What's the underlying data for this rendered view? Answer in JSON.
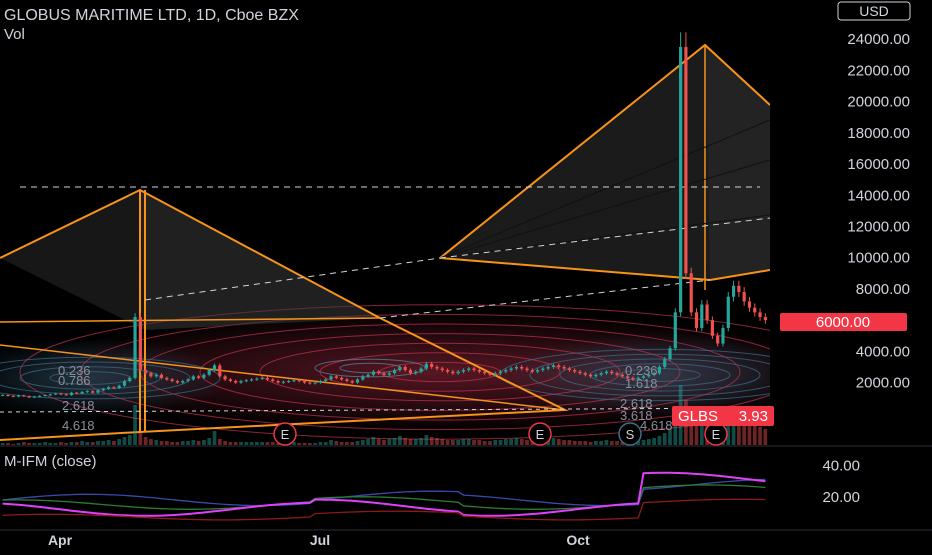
{
  "header": {
    "title": "GLOBUS MARITIME LTD, 1D, Cboe BZX",
    "volume_label": "Vol"
  },
  "currency_button": "USD",
  "indicator_label": "M-IFM (close)",
  "price_badges": [
    {
      "label": "6000.00",
      "value": 6000,
      "color": "#f23645"
    },
    {
      "label": "GLBS",
      "value_text": "3.93",
      "color": "#f23645"
    }
  ],
  "event_markers": [
    {
      "label": "E",
      "kind": "earnings"
    },
    {
      "label": "E",
      "kind": "earnings"
    },
    {
      "label": "S",
      "kind": "split"
    },
    {
      "label": "E",
      "kind": "earnings"
    }
  ],
  "fib_labels": [
    "0.236",
    "0.786",
    "2.618",
    "4.618",
    "0.236",
    "1.618",
    "2.618",
    "3.618",
    "4.618"
  ],
  "colors": {
    "up": "#26a69a",
    "down": "#ef5350",
    "pattern": "#f7931a",
    "fib_blue": "#3d6e8a",
    "fib_red": "#c2334f",
    "ifm_line_1": "#e040fb",
    "ifm_line_2": "#8b1a1a",
    "ifm_line_3": "#3949ab",
    "ifm_line_4": "#2e7d32"
  },
  "chart_data": {
    "type": "candlestick",
    "title": "GLOBUS MARITIME LTD, 1D, Cboe BZX",
    "xlabel": "",
    "ylabel": "",
    "x_ticks": [
      "Apr",
      "Jul",
      "Oct"
    ],
    "y_ticks": [
      2000,
      4000,
      6000,
      8000,
      10000,
      12000,
      14000,
      16000,
      18000,
      20000,
      22000,
      24000
    ],
    "y_tick_labels": [
      "2000.00",
      "4000.00",
      "6000.00",
      "8000.00",
      "10000.00",
      "12000.00",
      "14000.00",
      "16000.00",
      "18000.00",
      "20000.00",
      "22000.00",
      "24000.00"
    ],
    "ylim": [
      -2000,
      26000
    ],
    "closes": [
      1200,
      1150,
      1100,
      1180,
      1120,
      1050,
      1100,
      1150,
      1200,
      1250,
      1300,
      1250,
      1200,
      1350,
      1300,
      1400,
      1450,
      1350,
      1500,
      1600,
      1700,
      1650,
      1800,
      2100,
      2300,
      6200,
      2800,
      2600,
      2400,
      2500,
      2300,
      2200,
      2100,
      2000,
      2100,
      2200,
      2400,
      2300,
      2500,
      2800,
      3100,
      2400,
      2200,
      2100,
      2000,
      2100,
      2150,
      2200,
      2250,
      2300,
      2200,
      2100,
      2000,
      2050,
      2100,
      2150,
      2100,
      2000,
      1950,
      2000,
      2100,
      2200,
      2400,
      2300,
      2200,
      2100,
      2000,
      2200,
      2400,
      2500,
      2700,
      2600,
      2500,
      2600,
      2800,
      3000,
      2800,
      2600,
      2700,
      2900,
      3200,
      3000,
      2900,
      2800,
      2700,
      2600,
      2700,
      2800,
      2900,
      2800,
      2700,
      2600,
      2500,
      2600,
      2700,
      2800,
      2900,
      3000,
      2900,
      2800,
      2700,
      2800,
      2900,
      3000,
      3100,
      3000,
      2900,
      2800,
      2700,
      2600,
      2500,
      2400,
      2500,
      2600,
      2700,
      2600,
      2500,
      2400,
      2300,
      2200,
      2300,
      2400,
      2500,
      2600,
      3000,
      3500,
      4200,
      6500,
      23500,
      9000,
      6500,
      5500,
      7000,
      6000,
      5000,
      4500,
      5500,
      7500,
      8200,
      7800,
      7200,
      6800,
      6500,
      6200,
      6000
    ],
    "volumes": [
      2,
      2,
      1,
      2,
      3,
      2,
      2,
      2,
      3,
      2,
      2,
      3,
      2,
      3,
      3,
      4,
      3,
      3,
      4,
      4,
      5,
      4,
      6,
      8,
      10,
      40,
      12,
      8,
      6,
      5,
      4,
      4,
      3,
      3,
      4,
      4,
      5,
      4,
      5,
      7,
      14,
      6,
      4,
      3,
      3,
      3,
      3,
      3,
      3,
      3,
      3,
      3,
      2,
      2,
      3,
      3,
      2,
      2,
      2,
      2,
      3,
      3,
      5,
      4,
      3,
      3,
      3,
      4,
      5,
      6,
      8,
      6,
      5,
      6,
      7,
      9,
      7,
      6,
      6,
      7,
      10,
      8,
      7,
      6,
      5,
      5,
      5,
      6,
      6,
      5,
      5,
      4,
      4,
      5,
      5,
      6,
      6,
      7,
      6,
      5,
      5,
      5,
      6,
      6,
      7,
      6,
      5,
      5,
      4,
      4,
      4,
      3,
      4,
      4,
      5,
      4,
      4,
      3,
      3,
      3,
      4,
      5,
      6,
      7,
      9,
      12,
      16,
      30,
      60,
      45,
      35,
      25,
      30,
      25,
      20,
      18,
      22,
      30,
      35,
      30,
      25,
      22,
      20,
      18,
      16
    ],
    "last_price": 6000,
    "symbol": "GLBS",
    "indicator": {
      "name": "M-IFM (close)",
      "y_ticks": [
        20,
        40
      ],
      "y_tick_labels": [
        "20.00",
        "40.00"
      ],
      "ylim": [
        0,
        50
      ]
    }
  }
}
